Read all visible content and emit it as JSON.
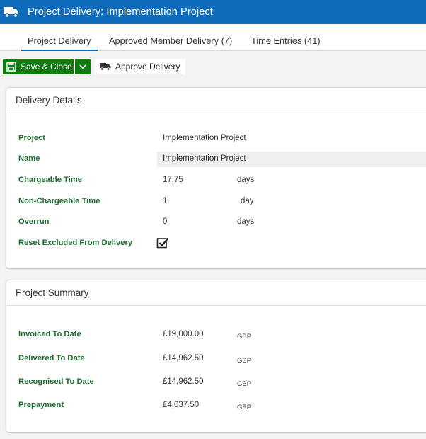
{
  "header": {
    "title": "Project Delivery: Implementation Project"
  },
  "tabs": [
    {
      "label": "Project Delivery"
    },
    {
      "label": "Approved Member Delivery (7)"
    },
    {
      "label": "Time Entries (41)"
    }
  ],
  "toolbar": {
    "save_close_label": "Save & Close",
    "approve_label": "Approve Delivery"
  },
  "delivery": {
    "title": "Delivery Details",
    "project_label": "Project",
    "project_value": "Implementation Project",
    "name_label": "Name",
    "name_value": "Implementation Project",
    "chargeable_label": "Chargeable Time",
    "chargeable_value": "17.75",
    "chargeable_unit": "days",
    "nonchargeable_label": "Non-Chargeable Time",
    "nonchargeable_value": "1",
    "nonchargeable_unit": "day",
    "overrun_label": "Overrun",
    "overrun_value": "0",
    "overrun_unit": "days",
    "reset_label": "Reset Excluded From Delivery",
    "reset_checked": true
  },
  "summary": {
    "title": "Project Summary",
    "invoiced_label": "Invoiced To Date",
    "invoiced_value": "£19,000.00",
    "invoiced_currency": "GBP",
    "delivered_label": "Delivered To Date",
    "delivered_value": "£14,962.50",
    "delivered_currency": "GBP",
    "recognised_label": "Recognised To Date",
    "recognised_value": "£14,962.50",
    "recognised_currency": "GBP",
    "prepayment_label": "Prepayment",
    "prepayment_value": "£4,037.50",
    "prepayment_currency": "GBP"
  },
  "colors": {
    "brand": "#0f6cbd",
    "save": "#107c10",
    "label": "#1e6b2e"
  }
}
